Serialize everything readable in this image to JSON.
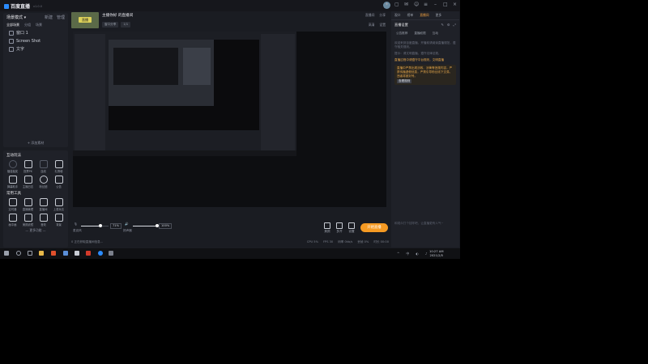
{
  "app": {
    "name": "百度直播",
    "version": "v1.0.0",
    "brand_color": "#2b8cff",
    "accent_color": "#f59a23"
  },
  "titlebar_icons": [
    "gift-icon",
    "message-icon",
    "mail-icon",
    "user-icon",
    "menu-icon",
    "minimize-icon",
    "maximize-icon",
    "close-icon"
  ],
  "scene_panel": {
    "title": "场景模式 ▾",
    "actions": [
      "新建",
      "管理"
    ],
    "tabs": [
      "全部场景",
      "分组",
      "场景"
    ],
    "items": [
      {
        "label": "窗口 1"
      },
      {
        "label": "Screen Shot"
      },
      {
        "label": "文字"
      }
    ],
    "add_source_label": "+ 添加素材"
  },
  "tools_panel": {
    "title": "互动玩法",
    "row1": [
      "福袋抽奖",
      "投票PK",
      "连线",
      "礼物墙"
    ],
    "row2": [
      "弹幕助手",
      "主播日志",
      "粉丝团",
      "公告"
    ],
    "section2_title": "常用工具",
    "row3": [
      "定时器",
      "直播管理",
      "直播间",
      "上麦玩法"
    ],
    "row4": [
      "画中画",
      "美颜滤镜",
      "音效",
      "背景"
    ],
    "more_label": "— 更多功能 —"
  },
  "header": {
    "room_title": "主播你好 的直播间",
    "tags": [
      "窗口分享",
      "1/1"
    ],
    "thumb_label": "直播",
    "right_top": [
      "直播间",
      "分享"
    ],
    "right_bottom": [
      "高清",
      "设置"
    ]
  },
  "controls": {
    "mic_label": "麦克风",
    "mic_value": "71%",
    "mic_level": 0.71,
    "speaker_label": "扬声器",
    "speaker_value": "100%",
    "speaker_level": 1.0,
    "buttons": [
      "美颜",
      "多开",
      "设置"
    ],
    "start_live_label": "开始直播"
  },
  "status": {
    "left": "0 正在获取直播间信息...",
    "right": [
      "CPU 5%",
      "FPS 30",
      "码率 0kb/s",
      "丢帧 0%",
      "时长 00:00"
    ]
  },
  "right_panel": {
    "tabs": [
      "观众",
      "榜单",
      "直播间",
      "更多"
    ],
    "active_tab": "直播间",
    "section_title": "直播设置",
    "segments": [
      "公告推荐",
      "直播权限",
      "互动"
    ],
    "messages": [
      "欢迎来到百度直播，开播前请阅读直播规范，遵守相关规则。",
      "提示：请文明直播，遵守法律法规。"
    ],
    "highlight": "直播过程中请遵守平台规则，文明直播",
    "notice": "直播中严禁出现涉政、涉黄等违规内容，严禁传播虚假信息，严禁引导粉丝线下交易，违者将被封号。",
    "notice_tag": "查看规则",
    "chat_placeholder": "和观众打个招呼吧，让直播更有人气~"
  },
  "taskbar": {
    "clock_time": "10:27 AM",
    "clock_date": "2021/2/5",
    "tray": [
      "^",
      "中",
      "◐",
      "♪"
    ]
  }
}
